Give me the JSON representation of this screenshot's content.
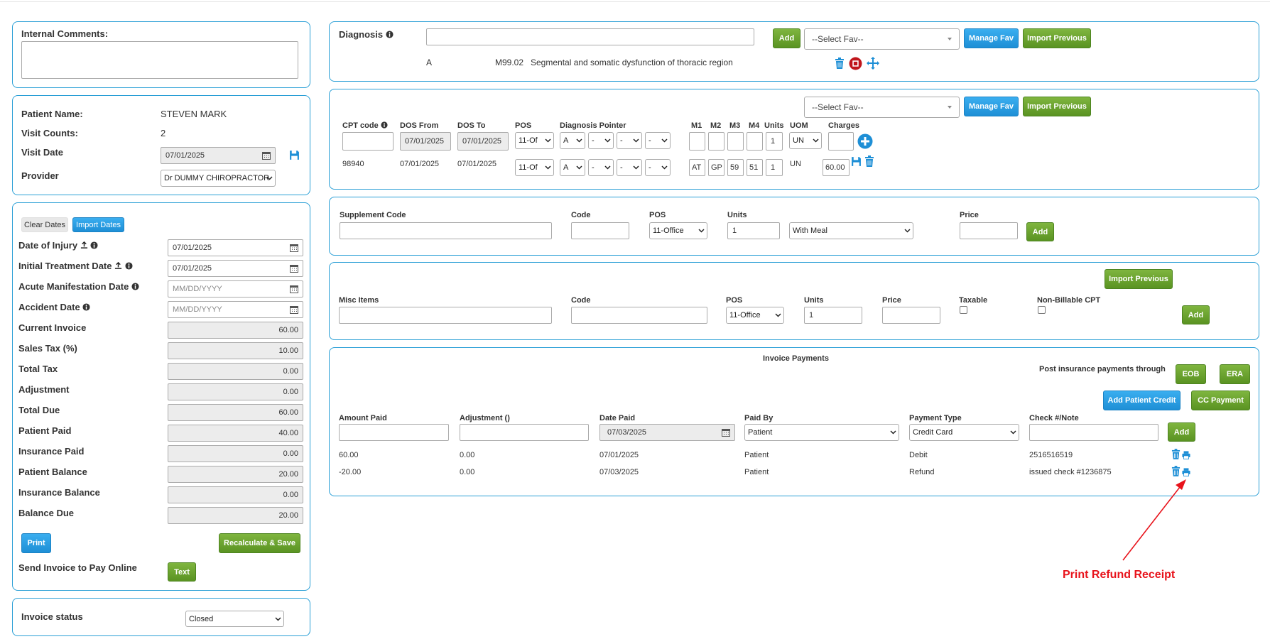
{
  "internal_comments": {
    "label": "Internal Comments:",
    "value": ""
  },
  "patient": {
    "name_label": "Patient Name:",
    "name_value": "STEVEN MARK",
    "visit_counts_label": "Visit Counts:",
    "visit_counts_value": "2",
    "visit_date_label": "Visit Date",
    "visit_date_value": "07/01/2025",
    "provider_label": "Provider",
    "provider_value": "Dr DUMMY CHIROPRACTOR"
  },
  "dates": {
    "clear_dates": "Clear Dates",
    "import_dates": "Import Dates",
    "date_of_injury_label": "Date of Injury",
    "date_of_injury_value": "07/01/2025",
    "initial_treatment_label": "Initial Treatment Date",
    "initial_treatment_value": "07/01/2025",
    "acute_manifestation_label": "Acute Manifestation Date",
    "acute_manifestation_placeholder": "MM/DD/YYYY",
    "accident_date_label": "Accident Date",
    "accident_date_placeholder": "MM/DD/YYYY"
  },
  "invoice_summary": [
    {
      "label": "Current Invoice",
      "value": "60.00"
    },
    {
      "label": "Sales Tax (%)",
      "value": "10.00"
    },
    {
      "label": "Total Tax",
      "value": "0.00"
    },
    {
      "label": "Adjustment",
      "value": "0.00"
    },
    {
      "label": "Total Due",
      "value": "60.00"
    },
    {
      "label": "Patient Paid",
      "value": "40.00"
    },
    {
      "label": "Insurance Paid",
      "value": "0.00"
    },
    {
      "label": "Patient Balance",
      "value": "20.00"
    },
    {
      "label": "Insurance Balance",
      "value": "0.00"
    },
    {
      "label": "Balance Due",
      "value": "20.00"
    }
  ],
  "actions": {
    "print": "Print",
    "recalculate": "Recalculate & Save",
    "send_invoice_label": "Send Invoice to Pay Online",
    "text_button": "Text"
  },
  "invoice_status": {
    "label": "Invoice status",
    "value": "Closed"
  },
  "diagnosis": {
    "title": "Diagnosis",
    "add": "Add",
    "select_fav": "--Select Fav--",
    "manage_fav": "Manage Fav",
    "import_previous": "Import Previous",
    "row": {
      "pointer": "A",
      "code": "M99.02",
      "description": "Segmental and somatic dysfunction of thoracic region"
    }
  },
  "cpt": {
    "select_fav": "--Select Fav--",
    "manage_fav": "Manage Fav",
    "import_previous": "Import Previous",
    "headers": {
      "cpt_code": "CPT code",
      "dos_from": "DOS From",
      "dos_to": "DOS To",
      "pos": "POS",
      "diagnosis_pointer": "Diagnosis Pointer",
      "m1": "M1",
      "m2": "M2",
      "m3": "M3",
      "m4": "M4",
      "units": "Units",
      "uom": "UOM",
      "charges": "Charges"
    },
    "new_row": {
      "dos_from": "07/01/2025",
      "dos_to": "07/01/2025",
      "pos": "11-Of",
      "dx": [
        "A",
        "-",
        "-",
        "-"
      ],
      "units": "1",
      "uom": "UN"
    },
    "row": {
      "code": "98940",
      "dos_from": "07/01/2025",
      "dos_to": "07/01/2025",
      "pos": "11-Of",
      "dx": [
        "A",
        "-",
        "-",
        "-"
      ],
      "m1": "AT",
      "m2": "GP",
      "m3": "59",
      "m4": "51",
      "units": "1",
      "uom": "UN",
      "charges": "60.00"
    }
  },
  "supplement": {
    "code_label": "Supplement Code",
    "code2_label": "Code",
    "pos_label": "POS",
    "units_label": "Units",
    "price_label": "Price",
    "pos_value": "11-Office",
    "units_value": "1",
    "meal_value": "With Meal",
    "add": "Add"
  },
  "misc": {
    "import_previous": "Import Previous",
    "items_label": "Misc Items",
    "code_label": "Code",
    "pos_label": "POS",
    "units_label": "Units",
    "price_label": "Price",
    "taxable_label": "Taxable",
    "nonbillable_label": "Non-Billable CPT",
    "pos_value": "11-Office",
    "units_value": "1",
    "add": "Add"
  },
  "payments": {
    "title": "Invoice Payments",
    "post_label": "Post insurance payments through",
    "eob": "EOB",
    "era": "ERA",
    "add_patient_credit": "Add Patient Credit",
    "cc_payment": "CC Payment",
    "headers": {
      "amount_paid": "Amount Paid",
      "adjustment": "Adjustment ()",
      "date_paid": "Date Paid",
      "paid_by": "Paid By",
      "payment_type": "Payment Type",
      "check_note": "Check #/Note"
    },
    "form": {
      "date_paid": "07/03/2025",
      "paid_by": "Patient",
      "payment_type": "Credit Card",
      "add": "Add"
    },
    "rows": [
      {
        "amount": "60.00",
        "adjustment": "0.00",
        "date": "07/01/2025",
        "paid_by": "Patient",
        "type": "Debit",
        "note": "2516516519"
      },
      {
        "amount": "-20.00",
        "adjustment": "0.00",
        "date": "07/03/2025",
        "paid_by": "Patient",
        "type": "Refund",
        "note": "issued check #1236875"
      }
    ]
  },
  "annotation": {
    "text": "Print Refund Receipt",
    "color": "#e8131b"
  },
  "colors": {
    "panel_border": "#2a9fd6",
    "green": "#5a9322",
    "blue": "#1e8fd6"
  }
}
